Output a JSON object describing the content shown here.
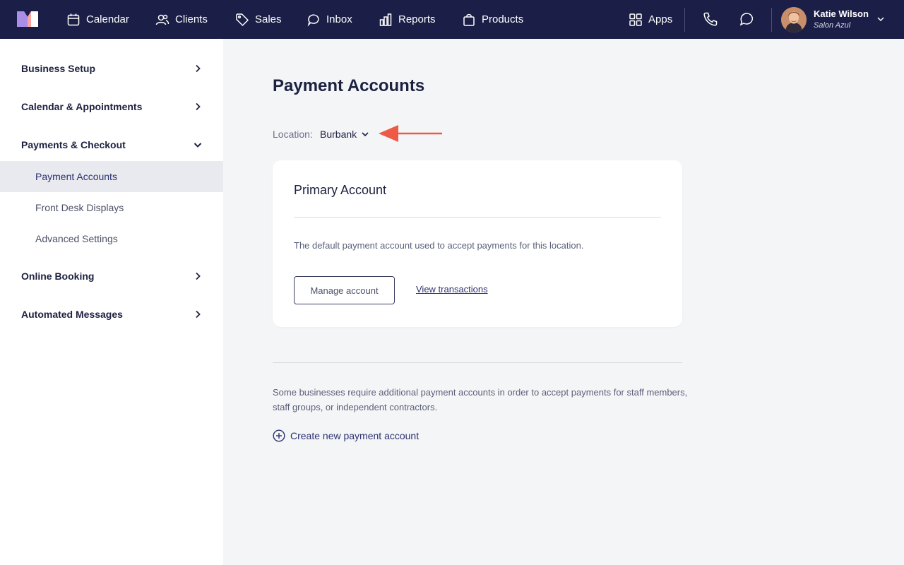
{
  "topnav": {
    "items": [
      {
        "label": "Calendar",
        "icon": "calendar-icon"
      },
      {
        "label": "Clients",
        "icon": "clients-icon"
      },
      {
        "label": "Sales",
        "icon": "tag-icon"
      },
      {
        "label": "Inbox",
        "icon": "inbox-icon"
      },
      {
        "label": "Reports",
        "icon": "bar-chart-icon"
      },
      {
        "label": "Products",
        "icon": "shopping-bag-icon"
      }
    ],
    "apps_label": "Apps",
    "user": {
      "name": "Katie Wilson",
      "business": "Salon Azul"
    }
  },
  "sidebar": {
    "sections": [
      {
        "label": "Business Setup",
        "expanded": false
      },
      {
        "label": "Calendar & Appointments",
        "expanded": false
      },
      {
        "label": "Payments & Checkout",
        "expanded": true,
        "children": [
          {
            "label": "Payment Accounts",
            "active": true
          },
          {
            "label": "Front Desk Displays",
            "active": false
          },
          {
            "label": "Advanced Settings",
            "active": false
          }
        ]
      },
      {
        "label": "Online Booking",
        "expanded": false
      },
      {
        "label": "Automated Messages",
        "expanded": false
      }
    ]
  },
  "main": {
    "title": "Payment Accounts",
    "location_label": "Location:",
    "location_value": "Burbank",
    "primary_card": {
      "title": "Primary Account",
      "description": "The default payment account used to accept payments for this location.",
      "manage_button": "Manage account",
      "transactions_link": "View transactions"
    },
    "info_text": "Some businesses require additional payment accounts in order to accept payments for staff members, staff groups, or independent contractors.",
    "create_link": "Create new payment account"
  },
  "colors": {
    "topbar": "#1b1f47",
    "sidebar_active": "#e9eaef",
    "annotation_arrow": "#ef5a47",
    "link": "#2c3170"
  }
}
